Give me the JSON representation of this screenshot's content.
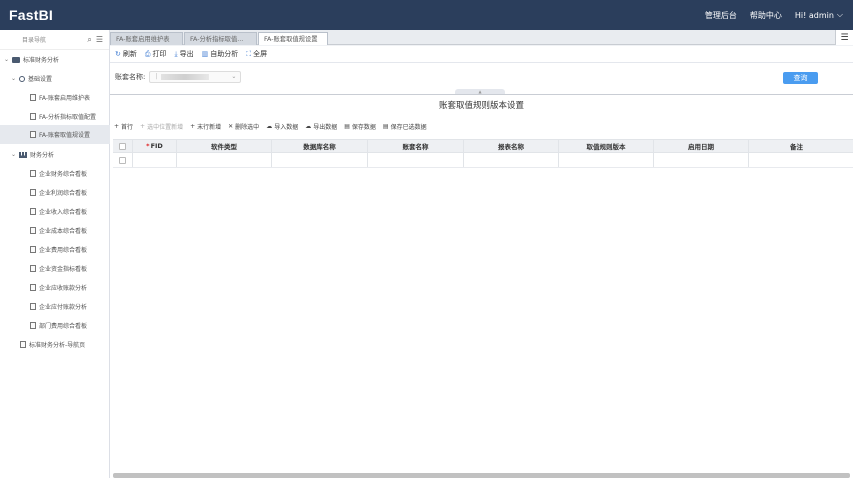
{
  "header": {
    "brand": "FastBI",
    "nav": [
      "管理后台",
      "帮助中心"
    ],
    "greeting": "Hi! admin",
    "chevron": "⌵"
  },
  "sidebar": {
    "title": "目录导航",
    "root": "标准财务分析",
    "group_basic": "基础设置",
    "basic_items": [
      "FA-账套启用维护表",
      "FA-分析指标取值配置",
      "FA-账套取值规设置"
    ],
    "group_finance": "财务分析",
    "finance_items": [
      "企业财务综合看板",
      "企业利润综合看板",
      "企业收入综合看板",
      "企业成本综合看板",
      "企业费用综合看板",
      "企业资金指标看板",
      "企业应收账款分析",
      "企业应付账款分析",
      "部门费用综合看板"
    ],
    "bottom_item": "标准财务分析-导航页"
  },
  "tabs": [
    {
      "label": "FA-账套启用维护表"
    },
    {
      "label": "FA-分析指标取值..."
    },
    {
      "label": "FA-账套取值规设置"
    }
  ],
  "toolbar": {
    "refresh": "刷新",
    "print": "打印",
    "export": "导出",
    "self_analysis": "自助分析",
    "fullscreen": "全屏"
  },
  "query": {
    "label": "账套名称:",
    "button": "查询"
  },
  "grid": {
    "title": "账套取值规则版本设置",
    "actions": [
      {
        "label": "首行",
        "icon": "+",
        "disabled": false
      },
      {
        "label": "选中位置新增",
        "icon": "+",
        "disabled": true
      },
      {
        "label": "末行新增",
        "icon": "+",
        "disabled": false
      },
      {
        "label": "删除选中",
        "icon": "✕",
        "disabled": false
      },
      {
        "label": "导入数据",
        "icon": "☁",
        "disabled": false
      },
      {
        "label": "导出数据",
        "icon": "☁",
        "disabled": false
      },
      {
        "label": "保存数据",
        "icon": "▤",
        "disabled": false
      },
      {
        "label": "保存已选数据",
        "icon": "▤",
        "disabled": false
      }
    ],
    "columns": [
      "FID",
      "软件类型",
      "数据库名称",
      "账套名称",
      "报表名称",
      "取值规则版本",
      "启用日期",
      "备注"
    ],
    "required_mark": "*"
  },
  "colors": {
    "topbar": "#2b3e5c",
    "accent": "#4a9cf0"
  }
}
